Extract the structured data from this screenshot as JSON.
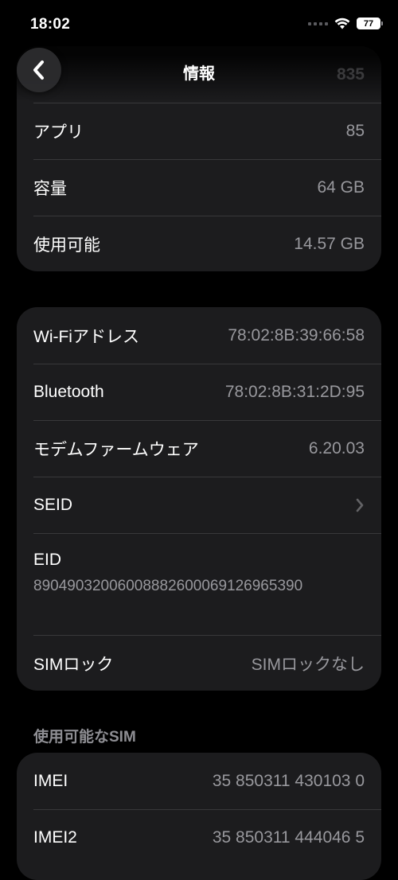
{
  "status_bar": {
    "time": "18:02",
    "battery": "77"
  },
  "nav": {
    "title": "情報",
    "ghost_value": "835"
  },
  "card_storage": [
    {
      "label": "アプリ",
      "value": "85"
    },
    {
      "label": "容量",
      "value": "64 GB"
    },
    {
      "label": "使用可能",
      "value": "14.57 GB"
    }
  ],
  "card_network": {
    "wifi": {
      "label": "Wi-Fiアドレス",
      "value": "78:02:8B:39:66:58"
    },
    "bluetooth": {
      "label": "Bluetooth",
      "value": "78:02:8B:31:2D:95"
    },
    "modem": {
      "label": "モデムファームウェア",
      "value": "6.20.03"
    },
    "seid": {
      "label": "SEID"
    },
    "eid": {
      "label": "EID",
      "value": "89049032006008882600069126965390"
    },
    "sim_lock": {
      "label": "SIMロック",
      "value": "SIMロックなし"
    }
  },
  "sim_section": {
    "header": "使用可能なSIM",
    "rows": [
      {
        "label": "IMEI",
        "value": "35 850311 430103 0"
      },
      {
        "label": "IMEI2",
        "value": "35 850311 444046 5"
      }
    ]
  },
  "colors": {
    "background": "#000000",
    "card": "#1c1c1e",
    "separator": "#38383a",
    "secondary_text": "#98989d"
  }
}
